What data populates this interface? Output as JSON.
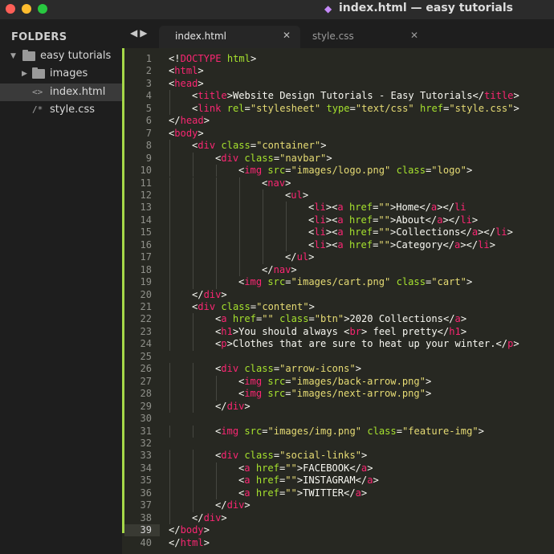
{
  "window": {
    "title": "index.html — easy tutorials",
    "app_icon": "sublime-text-icon"
  },
  "sidebar": {
    "heading": "FOLDERS",
    "items": [
      {
        "label": "easy tutorials",
        "icon": "folder-icon",
        "expanded": true
      },
      {
        "label": "images",
        "icon": "folder-icon",
        "expanded": false
      },
      {
        "label": "index.html",
        "icon": "code-file-icon",
        "selected": true
      },
      {
        "label": "style.css",
        "icon": "comment-file-icon"
      }
    ]
  },
  "tabs": [
    {
      "label": "index.html",
      "active": true
    },
    {
      "label": "style.css",
      "active": false
    }
  ],
  "editor": {
    "current_line": 39,
    "lines": [
      {
        "n": "1",
        "indent": 0,
        "tokens": [
          [
            "tx",
            "<!"
          ],
          [
            "dt",
            "DOCTYPE"
          ],
          [
            "tx",
            " "
          ],
          [
            "at",
            "html"
          ],
          [
            "tx",
            ">"
          ]
        ]
      },
      {
        "n": "2",
        "indent": 0,
        "tokens": [
          [
            "tx",
            "<"
          ],
          [
            "tg",
            "html"
          ],
          [
            "tx",
            ">"
          ]
        ]
      },
      {
        "n": "3",
        "indent": 0,
        "tokens": [
          [
            "tx",
            "<"
          ],
          [
            "tg",
            "head"
          ],
          [
            "tx",
            ">"
          ]
        ]
      },
      {
        "n": "4",
        "indent": 1,
        "tokens": [
          [
            "tx",
            "<"
          ],
          [
            "tg",
            "title"
          ],
          [
            "tx",
            ">Website Design Tutorials - Easy Tutorials</"
          ],
          [
            "tg",
            "title"
          ],
          [
            "tx",
            ">"
          ]
        ]
      },
      {
        "n": "5",
        "indent": 1,
        "tokens": [
          [
            "tx",
            "<"
          ],
          [
            "tg",
            "link"
          ],
          [
            "tx",
            " "
          ],
          [
            "at",
            "rel"
          ],
          [
            "tx",
            "="
          ],
          [
            "st",
            "\"stylesheet\""
          ],
          [
            "tx",
            " "
          ],
          [
            "at",
            "type"
          ],
          [
            "tx",
            "="
          ],
          [
            "st",
            "\"text/css\""
          ],
          [
            "tx",
            " "
          ],
          [
            "at",
            "href"
          ],
          [
            "tx",
            "="
          ],
          [
            "st",
            "\"style.css\""
          ],
          [
            "tx",
            ">"
          ]
        ]
      },
      {
        "n": "6",
        "indent": 0,
        "tokens": [
          [
            "tx",
            "</"
          ],
          [
            "tg",
            "head"
          ],
          [
            "tx",
            ">"
          ]
        ]
      },
      {
        "n": "7",
        "indent": 0,
        "tokens": [
          [
            "tx",
            "<"
          ],
          [
            "tg",
            "body"
          ],
          [
            "tx",
            ">"
          ]
        ]
      },
      {
        "n": "8",
        "indent": 1,
        "tokens": [
          [
            "tx",
            "<"
          ],
          [
            "tg",
            "div"
          ],
          [
            "tx",
            " "
          ],
          [
            "at",
            "class"
          ],
          [
            "tx",
            "="
          ],
          [
            "st",
            "\"container\""
          ],
          [
            "tx",
            ">"
          ]
        ]
      },
      {
        "n": "9",
        "indent": 2,
        "tokens": [
          [
            "tx",
            "<"
          ],
          [
            "tg",
            "div"
          ],
          [
            "tx",
            " "
          ],
          [
            "at",
            "class"
          ],
          [
            "tx",
            "="
          ],
          [
            "st",
            "\"navbar\""
          ],
          [
            "tx",
            ">"
          ]
        ]
      },
      {
        "n": "10",
        "indent": 3,
        "tokens": [
          [
            "tx",
            "<"
          ],
          [
            "tg",
            "img"
          ],
          [
            "tx",
            " "
          ],
          [
            "at",
            "src"
          ],
          [
            "tx",
            "="
          ],
          [
            "st",
            "\"images/logo.png\""
          ],
          [
            "tx",
            " "
          ],
          [
            "at",
            "class"
          ],
          [
            "tx",
            "="
          ],
          [
            "st",
            "\"logo\""
          ],
          [
            "tx",
            ">"
          ]
        ]
      },
      {
        "n": "11",
        "indent": 4,
        "tokens": [
          [
            "tx",
            "<"
          ],
          [
            "tg",
            "nav"
          ],
          [
            "tx",
            ">"
          ]
        ]
      },
      {
        "n": "12",
        "indent": 5,
        "tokens": [
          [
            "tx",
            "<"
          ],
          [
            "tg",
            "ul"
          ],
          [
            "tx",
            ">"
          ]
        ]
      },
      {
        "n": "13",
        "indent": 6,
        "tokens": [
          [
            "tx",
            "<"
          ],
          [
            "tg",
            "li"
          ],
          [
            "tx",
            "><"
          ],
          [
            "tg",
            "a"
          ],
          [
            "tx",
            " "
          ],
          [
            "at",
            "href"
          ],
          [
            "tx",
            "="
          ],
          [
            "st",
            "\"\""
          ],
          [
            "tx",
            ">Home</"
          ],
          [
            "tg",
            "a"
          ],
          [
            "tx",
            "></"
          ],
          [
            "tg",
            "li"
          ]
        ]
      },
      {
        "n": "14",
        "indent": 6,
        "tokens": [
          [
            "tx",
            "<"
          ],
          [
            "tg",
            "li"
          ],
          [
            "tx",
            "><"
          ],
          [
            "tg",
            "a"
          ],
          [
            "tx",
            " "
          ],
          [
            "at",
            "href"
          ],
          [
            "tx",
            "="
          ],
          [
            "st",
            "\"\""
          ],
          [
            "tx",
            ">About</"
          ],
          [
            "tg",
            "a"
          ],
          [
            "tx",
            "></"
          ],
          [
            "tg",
            "li"
          ],
          [
            "tx",
            ">"
          ]
        ]
      },
      {
        "n": "15",
        "indent": 6,
        "tokens": [
          [
            "tx",
            "<"
          ],
          [
            "tg",
            "li"
          ],
          [
            "tx",
            "><"
          ],
          [
            "tg",
            "a"
          ],
          [
            "tx",
            " "
          ],
          [
            "at",
            "href"
          ],
          [
            "tx",
            "="
          ],
          [
            "st",
            "\"\""
          ],
          [
            "tx",
            ">Collections</"
          ],
          [
            "tg",
            "a"
          ],
          [
            "tx",
            "></"
          ],
          [
            "tg",
            "li"
          ],
          [
            "tx",
            ">"
          ]
        ]
      },
      {
        "n": "16",
        "indent": 6,
        "tokens": [
          [
            "tx",
            "<"
          ],
          [
            "tg",
            "li"
          ],
          [
            "tx",
            "><"
          ],
          [
            "tg",
            "a"
          ],
          [
            "tx",
            " "
          ],
          [
            "at",
            "href"
          ],
          [
            "tx",
            "="
          ],
          [
            "st",
            "\"\""
          ],
          [
            "tx",
            ">Category</"
          ],
          [
            "tg",
            "a"
          ],
          [
            "tx",
            "></"
          ],
          [
            "tg",
            "li"
          ],
          [
            "tx",
            ">"
          ]
        ]
      },
      {
        "n": "17",
        "indent": 5,
        "tokens": [
          [
            "tx",
            "</"
          ],
          [
            "tg",
            "ul"
          ],
          [
            "tx",
            ">"
          ]
        ]
      },
      {
        "n": "18",
        "indent": 4,
        "tokens": [
          [
            "tx",
            "</"
          ],
          [
            "tg",
            "nav"
          ],
          [
            "tx",
            ">"
          ]
        ]
      },
      {
        "n": "19",
        "indent": 3,
        "tokens": [
          [
            "tx",
            "<"
          ],
          [
            "tg",
            "img"
          ],
          [
            "tx",
            " "
          ],
          [
            "at",
            "src"
          ],
          [
            "tx",
            "="
          ],
          [
            "st",
            "\"images/cart.png\""
          ],
          [
            "tx",
            " "
          ],
          [
            "at",
            "class"
          ],
          [
            "tx",
            "="
          ],
          [
            "st",
            "\"cart\""
          ],
          [
            "tx",
            ">"
          ]
        ]
      },
      {
        "n": "20",
        "indent": 1,
        "tokens": [
          [
            "tx",
            "</"
          ],
          [
            "tg",
            "div"
          ],
          [
            "tx",
            ">"
          ]
        ]
      },
      {
        "n": "21",
        "indent": 1,
        "tokens": [
          [
            "tx",
            "<"
          ],
          [
            "tg",
            "div"
          ],
          [
            "tx",
            " "
          ],
          [
            "at",
            "class"
          ],
          [
            "tx",
            "="
          ],
          [
            "st",
            "\"content\""
          ],
          [
            "tx",
            ">"
          ]
        ]
      },
      {
        "n": "22",
        "indent": 2,
        "tokens": [
          [
            "tx",
            "<"
          ],
          [
            "tg",
            "a"
          ],
          [
            "tx",
            " "
          ],
          [
            "at",
            "href"
          ],
          [
            "tx",
            "="
          ],
          [
            "st",
            "\"\""
          ],
          [
            "tx",
            " "
          ],
          [
            "at",
            "class"
          ],
          [
            "tx",
            "="
          ],
          [
            "st",
            "\"btn\""
          ],
          [
            "tx",
            ">2020 Collections</"
          ],
          [
            "tg",
            "a"
          ],
          [
            "tx",
            ">"
          ]
        ]
      },
      {
        "n": "23",
        "indent": 2,
        "tokens": [
          [
            "tx",
            "<"
          ],
          [
            "tg",
            "h1"
          ],
          [
            "tx",
            ">You should always <"
          ],
          [
            "tg",
            "br"
          ],
          [
            "tx",
            "> feel pretty</"
          ],
          [
            "tg",
            "h1"
          ],
          [
            "tx",
            ">"
          ]
        ]
      },
      {
        "n": "24",
        "indent": 2,
        "tokens": [
          [
            "tx",
            "<"
          ],
          [
            "tg",
            "p"
          ],
          [
            "tx",
            ">Clothes that are sure to heat up your winter.</"
          ],
          [
            "tg",
            "p"
          ],
          [
            "tx",
            ">"
          ]
        ]
      },
      {
        "n": "25",
        "indent": 0,
        "tokens": []
      },
      {
        "n": "26",
        "indent": 2,
        "tokens": [
          [
            "tx",
            "<"
          ],
          [
            "tg",
            "div"
          ],
          [
            "tx",
            " "
          ],
          [
            "at",
            "class"
          ],
          [
            "tx",
            "="
          ],
          [
            "st",
            "\"arrow-icons\""
          ],
          [
            "tx",
            ">"
          ]
        ]
      },
      {
        "n": "27",
        "indent": 3,
        "tokens": [
          [
            "tx",
            "<"
          ],
          [
            "tg",
            "img"
          ],
          [
            "tx",
            " "
          ],
          [
            "at",
            "src"
          ],
          [
            "tx",
            "="
          ],
          [
            "st",
            "\"images/back-arrow.png\""
          ],
          [
            "tx",
            ">"
          ]
        ]
      },
      {
        "n": "28",
        "indent": 3,
        "tokens": [
          [
            "tx",
            "<"
          ],
          [
            "tg",
            "img"
          ],
          [
            "tx",
            " "
          ],
          [
            "at",
            "src"
          ],
          [
            "tx",
            "="
          ],
          [
            "st",
            "\"images/next-arrow.png\""
          ],
          [
            "tx",
            ">"
          ]
        ]
      },
      {
        "n": "29",
        "indent": 2,
        "tokens": [
          [
            "tx",
            "</"
          ],
          [
            "tg",
            "div"
          ],
          [
            "tx",
            ">"
          ]
        ]
      },
      {
        "n": "30",
        "indent": 0,
        "tokens": []
      },
      {
        "n": "31",
        "indent": 2,
        "tokens": [
          [
            "tx",
            "<"
          ],
          [
            "tg",
            "img"
          ],
          [
            "tx",
            " "
          ],
          [
            "at",
            "src"
          ],
          [
            "tx",
            "="
          ],
          [
            "st",
            "\"images/img.png\""
          ],
          [
            "tx",
            " "
          ],
          [
            "at",
            "class"
          ],
          [
            "tx",
            "="
          ],
          [
            "st",
            "\"feature-img\""
          ],
          [
            "tx",
            ">"
          ]
        ]
      },
      {
        "n": "32",
        "indent": 0,
        "tokens": []
      },
      {
        "n": "33",
        "indent": 2,
        "tokens": [
          [
            "tx",
            "<"
          ],
          [
            "tg",
            "div"
          ],
          [
            "tx",
            " "
          ],
          [
            "at",
            "class"
          ],
          [
            "tx",
            "="
          ],
          [
            "st",
            "\"social-links\""
          ],
          [
            "tx",
            ">"
          ]
        ]
      },
      {
        "n": "34",
        "indent": 3,
        "tokens": [
          [
            "tx",
            "<"
          ],
          [
            "tg",
            "a"
          ],
          [
            "tx",
            " "
          ],
          [
            "at",
            "href"
          ],
          [
            "tx",
            "="
          ],
          [
            "st",
            "\"\""
          ],
          [
            "tx",
            ">FACEBOOK</"
          ],
          [
            "tg",
            "a"
          ],
          [
            "tx",
            ">"
          ]
        ]
      },
      {
        "n": "35",
        "indent": 3,
        "tokens": [
          [
            "tx",
            "<"
          ],
          [
            "tg",
            "a"
          ],
          [
            "tx",
            " "
          ],
          [
            "at",
            "href"
          ],
          [
            "tx",
            "="
          ],
          [
            "st",
            "\"\""
          ],
          [
            "tx",
            ">INSTAGRAM</"
          ],
          [
            "tg",
            "a"
          ],
          [
            "tx",
            ">"
          ]
        ]
      },
      {
        "n": "36",
        "indent": 3,
        "tokens": [
          [
            "tx",
            "<"
          ],
          [
            "tg",
            "a"
          ],
          [
            "tx",
            " "
          ],
          [
            "at",
            "href"
          ],
          [
            "tx",
            "="
          ],
          [
            "st",
            "\"\""
          ],
          [
            "tx",
            ">TWITTER</"
          ],
          [
            "tg",
            "a"
          ],
          [
            "tx",
            ">"
          ]
        ]
      },
      {
        "n": "37",
        "indent": 2,
        "tokens": [
          [
            "tx",
            "</"
          ],
          [
            "tg",
            "div"
          ],
          [
            "tx",
            ">"
          ]
        ]
      },
      {
        "n": "38",
        "indent": 1,
        "tokens": [
          [
            "tx",
            "</"
          ],
          [
            "tg",
            "div"
          ],
          [
            "tx",
            ">"
          ]
        ]
      },
      {
        "n": "39",
        "indent": 0,
        "tokens": [
          [
            "tx",
            "</"
          ],
          [
            "tg",
            "body"
          ],
          [
            "tx",
            ">"
          ]
        ]
      },
      {
        "n": "40",
        "indent": 0,
        "tokens": [
          [
            "tx",
            "</"
          ],
          [
            "tg",
            "html"
          ],
          [
            "tx",
            ">"
          ]
        ]
      }
    ]
  },
  "colors": {
    "tag": "#f92672",
    "attribute": "#a6e22e",
    "string": "#e6db74",
    "text": "#f8f8f2",
    "editor_bg": "#272822",
    "modified_marker": "#a6d848"
  }
}
